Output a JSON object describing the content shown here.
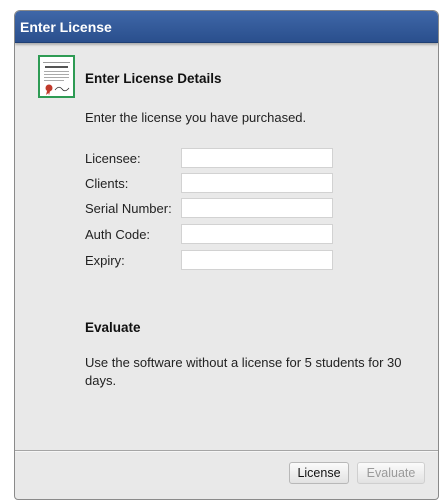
{
  "dialog": {
    "title": "Enter License"
  },
  "header": {
    "icon": "certificate-icon",
    "heading": "Enter License Details",
    "subtext": "Enter the license you have purchased."
  },
  "form": {
    "fields": [
      {
        "label": "Licensee:",
        "value": ""
      },
      {
        "label": "Clients:",
        "value": ""
      },
      {
        "label": "Serial Number:",
        "value": ""
      },
      {
        "label": "Auth Code:",
        "value": ""
      },
      {
        "label": "Expiry:",
        "value": ""
      }
    ]
  },
  "evaluate": {
    "heading": "Evaluate",
    "text": "Use the software without a license for 5 students for 30 days."
  },
  "buttons": {
    "license_label": "License",
    "evaluate_label": "Evaluate"
  },
  "colors": {
    "titlebar": "#2f5597",
    "dialog_bg": "#e9e9e9",
    "icon_border": "#2e9b54"
  }
}
